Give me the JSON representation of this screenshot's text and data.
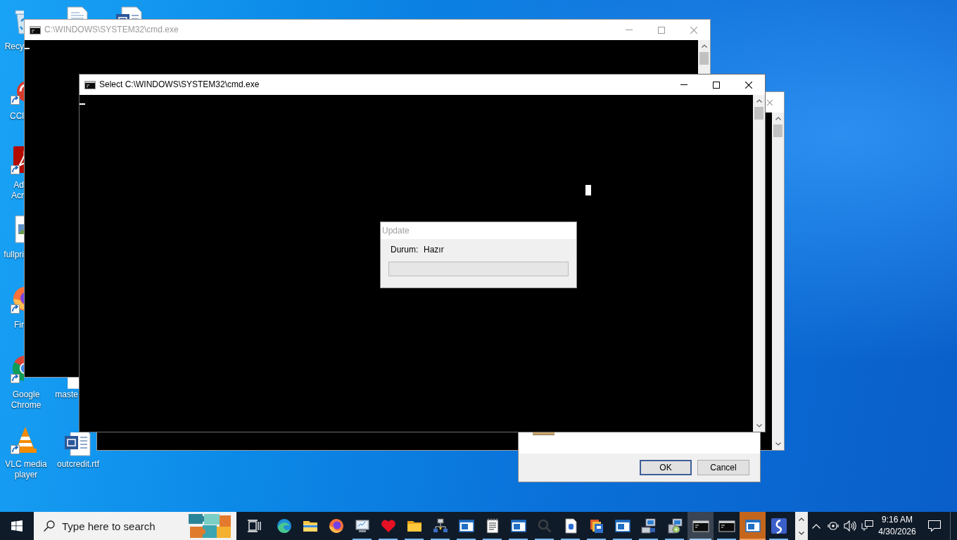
{
  "desktop": {
    "icons": [
      {
        "kind": "bin",
        "label": "Recy",
        "shortcut": false
      },
      {
        "kind": "document"
      },
      {
        "kind": "word"
      },
      {
        "kind": "cleaner",
        "label": "CCl",
        "shortcut": true
      },
      {
        "kind": "reader",
        "label": "Ad\nAcr",
        "shortcut": true
      },
      {
        "kind": "image",
        "label": "fullpri",
        "shortcut": false
      },
      {
        "kind": "firefox",
        "label": "Fir",
        "shortcut": true
      },
      {
        "kind": "chrome",
        "label": "Google Chrome",
        "shortcut": true
      },
      {
        "kind": "page",
        "label": "maste"
      },
      {
        "kind": "vlc",
        "label": "VLC media player",
        "shortcut": true
      },
      {
        "kind": "word",
        "label": "outcredit.rtf",
        "shortcut": false
      }
    ]
  },
  "windows": [
    {
      "title": "C:\\WINDOWS\\SYSTEM32\\cmd.exe",
      "active": false
    },
    {
      "title": "Select C:\\WINDOWS\\SYSTEM32\\cmd.exe",
      "active": true
    }
  ],
  "update_dialog": {
    "title": "Update",
    "active": false,
    "status_label": "Durum:",
    "status_value": "Hazır",
    "progress": {
      "level": 0
    }
  },
  "confirm_dialog": {
    "buttons": [
      {
        "label": "OK",
        "default": true
      },
      {
        "label": "Cancel",
        "default": false
      }
    ]
  },
  "taskbar": {
    "search": {
      "placeholder": "Type here to search"
    },
    "apps": [
      {
        "kind": "edge",
        "running": false,
        "selected": false,
        "flashing": false
      },
      {
        "kind": "explorer",
        "running": false,
        "selected": false,
        "flashing": false
      },
      {
        "kind": "firefox",
        "running": false,
        "selected": false,
        "flashing": false
      },
      {
        "kind": "monitor",
        "running": true,
        "selected": false,
        "flashing": false
      },
      {
        "kind": "heart",
        "running": true,
        "selected": false,
        "flashing": false
      },
      {
        "kind": "folder",
        "running": true,
        "selected": false,
        "flashing": false
      },
      {
        "kind": "network",
        "running": true,
        "selected": false,
        "flashing": false
      },
      {
        "kind": "window",
        "running": true,
        "selected": false,
        "flashing": false
      },
      {
        "kind": "notepad",
        "running": true,
        "selected": false,
        "flashing": false
      },
      {
        "kind": "window",
        "running": true,
        "selected": false,
        "flashing": false
      },
      {
        "kind": "magnifier",
        "running": true,
        "selected": false,
        "flashing": false
      },
      {
        "kind": "bdoc",
        "running": true,
        "selected": false,
        "flashing": false
      },
      {
        "kind": "cabinet",
        "running": true,
        "selected": false,
        "flashing": false
      },
      {
        "kind": "window",
        "running": true,
        "selected": false,
        "flashing": false
      },
      {
        "kind": "computer",
        "running": true,
        "selected": false,
        "flashing": false
      },
      {
        "kind": "installer",
        "running": true,
        "selected": false,
        "flashing": false
      },
      {
        "kind": "console",
        "running": true,
        "selected": true,
        "flashing": false
      },
      {
        "kind": "console",
        "running": true,
        "selected": false,
        "flashing": false
      },
      {
        "kind": "window",
        "running": true,
        "selected": false,
        "flashing": true
      },
      {
        "kind": "swirl",
        "running": true,
        "selected": false,
        "flashing": false
      }
    ],
    "clock": {
      "time": "9:16 AM",
      "date": "4/30/2026"
    }
  }
}
